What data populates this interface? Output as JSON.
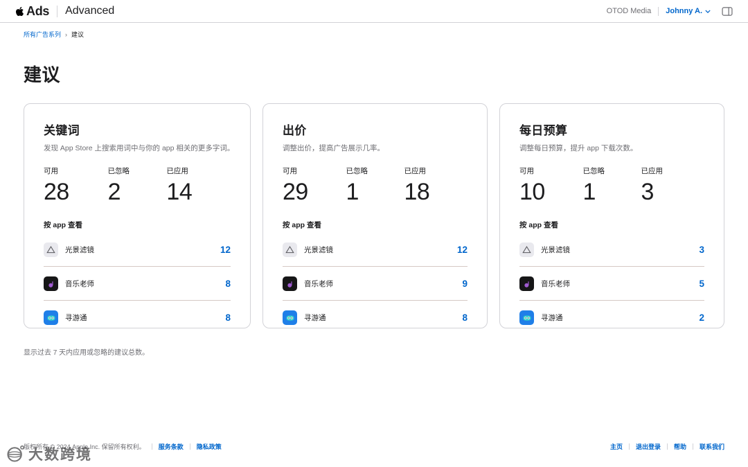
{
  "colors": {
    "accent": "#0066cc",
    "border": "#d2d2d7",
    "text_secondary": "#6e6e73"
  },
  "header": {
    "brand": "Ads",
    "product": "Advanced",
    "org": "OTOD Media",
    "user": "Johnny A."
  },
  "breadcrumb": {
    "parent": "所有广告系列",
    "separator": "›",
    "current": "建议"
  },
  "page": {
    "title": "建议",
    "footnote": "显示过去 7 天内应用或忽略的建议总数。"
  },
  "cards": [
    {
      "title": "关键词",
      "subtitle": "发现 App Store 上搜索用词中与你的 app 相关的更多字词。",
      "stats": [
        {
          "label": "可用",
          "value": "28"
        },
        {
          "label": "已忽略",
          "value": "2"
        },
        {
          "label": "已应用",
          "value": "14"
        }
      ],
      "by_app_label": "按 app 查看",
      "apps": [
        {
          "name": "光景滤镜",
          "count": "12"
        },
        {
          "name": "音乐老师",
          "count": "8"
        },
        {
          "name": "寻游通",
          "count": "8"
        }
      ]
    },
    {
      "title": "出价",
      "subtitle": "调整出价，提高广告展示几率。",
      "stats": [
        {
          "label": "可用",
          "value": "29"
        },
        {
          "label": "已忽略",
          "value": "1"
        },
        {
          "label": "已应用",
          "value": "18"
        }
      ],
      "by_app_label": "按 app 查看",
      "apps": [
        {
          "name": "光景滤镜",
          "count": "12"
        },
        {
          "name": "音乐老师",
          "count": "9"
        },
        {
          "name": "寻游通",
          "count": "8"
        }
      ]
    },
    {
      "title": "每日预算",
      "subtitle": "调整每日预算，提升 app 下载次数。",
      "stats": [
        {
          "label": "可用",
          "value": "10"
        },
        {
          "label": "已忽略",
          "value": "1"
        },
        {
          "label": "已应用",
          "value": "3"
        }
      ],
      "by_app_label": "按 app 查看",
      "apps": [
        {
          "name": "光景滤镜",
          "count": "3"
        },
        {
          "name": "音乐老师",
          "count": "5"
        },
        {
          "name": "寻游通",
          "count": "2"
        }
      ]
    }
  ],
  "footer": {
    "copyright": "版权所有 © 2024 Apple Inc. 保留所有权利。",
    "links_left": [
      "服务条款",
      "隐私政策"
    ],
    "links_right": [
      "主页",
      "退出登录",
      "帮助",
      "联系我们"
    ]
  },
  "watermark": {
    "text": "大数跨境"
  }
}
